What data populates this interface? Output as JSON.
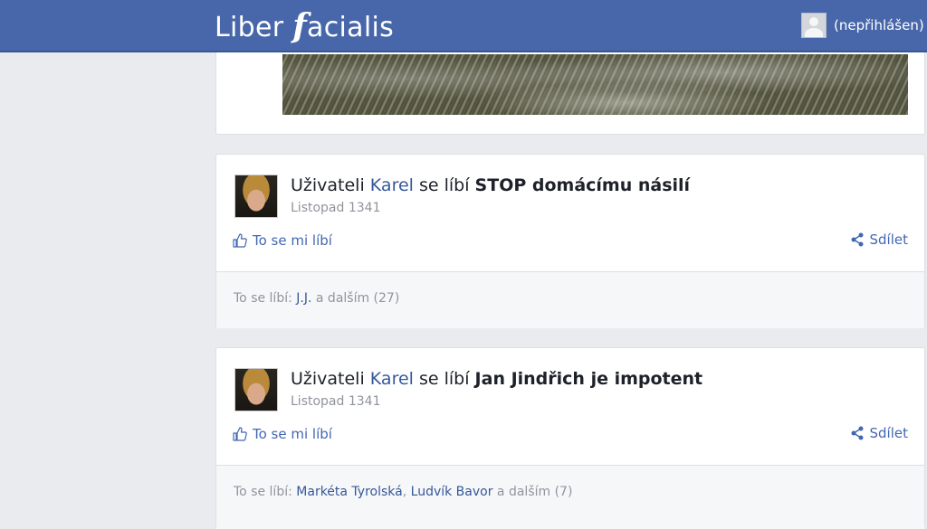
{
  "header": {
    "logo_left": "Liber ",
    "logo_f": "f",
    "logo_right": "acialis",
    "user_status": "(nepřihlášen)"
  },
  "posts": [
    {
      "prefix": "Uživateli ",
      "user": "Karel",
      "verb": " se líbí ",
      "page": "STOP domácímu násilí",
      "date": "Listopad 1341",
      "like_label": "To se mi líbí",
      "share_label": "Sdílet",
      "likes_prefix": "To se líbí: ",
      "likers": [
        "J.J."
      ],
      "likes_suffix": " a dalším (27)"
    },
    {
      "prefix": "Uživateli ",
      "user": "Karel",
      "verb": " se líbí ",
      "page": "Jan Jindřich je impotent",
      "date": "Listopad 1341",
      "like_label": "To se mi líbí",
      "share_label": "Sdílet",
      "likes_prefix": "To se líbí: ",
      "likers": [
        "Markéta Tyrolská",
        "Ludvík Bavor"
      ],
      "likers_sep": ", ",
      "likes_suffix": " a dalším (7)"
    }
  ],
  "icons": {
    "like": "thumbs-up-icon",
    "share": "share-icon",
    "user": "default-avatar-icon"
  },
  "colors": {
    "brand": "#4867aa",
    "link": "#365899",
    "muted": "#90949c"
  }
}
